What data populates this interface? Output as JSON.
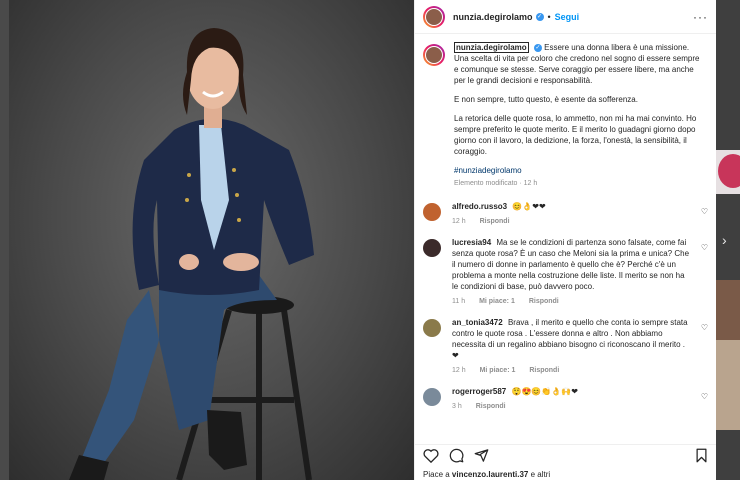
{
  "post": {
    "username": "nunzia.degirolamo",
    "follow_label": "Segui",
    "separator": "•",
    "more_label": "···",
    "caption": {
      "username": "nunzia.degirolamo",
      "paragraph1": "Essere una donna libera è una missione. Una scelta di vita per coloro che credono nel sogno di essere sempre e comunque se stesse. Serve coraggio per essere libere, ma anche per le grandi decisioni e responsabilità.",
      "paragraph2": "E non sempre, tutto questo, è esente da sofferenza.",
      "paragraph3": "La retorica delle quote rosa, lo ammetto, non mi ha mai convinto. Ho sempre preferito le quote merito. E il merito lo guadagni giorno dopo giorno con il lavoro, la dedizione, la forza, l'onestà, la sensibilità, il coraggio.",
      "hashtag": "#nunziadegirolamo",
      "meta": "Elemento modificato · 12 h"
    },
    "comments": [
      {
        "user": "alfredo.russo3",
        "text": "😊👌❤❤",
        "time": "12 h",
        "likes": "",
        "reply": "Rispondi",
        "avatar_color": "#c0622f"
      },
      {
        "user": "lucresia94",
        "text": "Ma se le condizioni di partenza sono falsate, come fai senza quote rosa? È un caso che Meloni sia la prima e unica? Che il numero di donne in parlamento è quello che è? Perché c'è un problema a monte nella costruzione delle liste. Il merito se non ha le condizioni di base, può davvero poco.",
        "time": "11 h",
        "likes": "Mi piace: 1",
        "reply": "Rispondi",
        "avatar_color": "#3b2a2a"
      },
      {
        "user": "an_tonia3472",
        "text": "Brava , il merito e quello che conta io sempre stata contro le quote rosa . L'essere donna e altro . Non abbiamo necessita di un regalino abbiano bisogno ci riconoscano il merito . ❤",
        "time": "12 h",
        "likes": "Mi piace: 1",
        "reply": "Rispondi",
        "avatar_color": "#8a7a4a"
      },
      {
        "user": "rogerroger587",
        "text": "😲😍😊👏👌🙌❤",
        "time": "3 h",
        "likes": "",
        "reply": "Rispondi",
        "avatar_color": "#7a8a9a"
      }
    ],
    "likes_prefix": "Piace a ",
    "likes_user": "vincenzo.laurenti.37",
    "likes_suffix": " e altri"
  },
  "icons": {
    "like": "heart-icon",
    "comment": "comment-icon",
    "share": "share-icon",
    "save": "bookmark-icon",
    "verified": "verified-badge-icon",
    "next": "chevron-right-icon"
  },
  "colors": {
    "link": "#0095f6",
    "hashtag": "#00376b",
    "verified": "#3897f0",
    "muted": "#8e8e8e"
  }
}
